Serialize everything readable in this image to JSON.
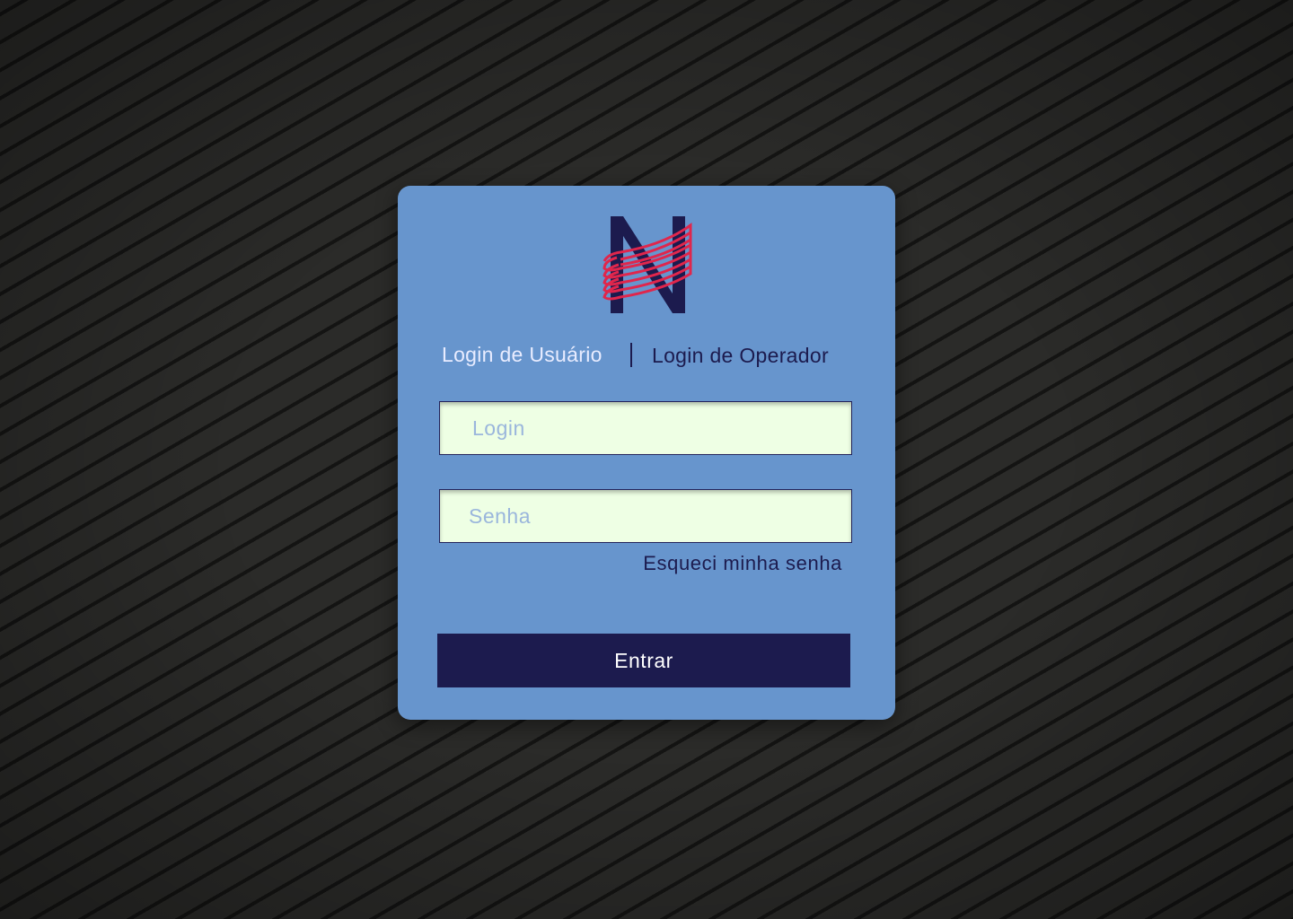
{
  "tabs": {
    "user_label": "Login de Usuário",
    "operator_label": "Login de Operador"
  },
  "form": {
    "login_placeholder": "Login",
    "login_value": "",
    "password_placeholder": "Senha",
    "password_value": "",
    "forgot_label": "Esqueci minha senha",
    "submit_label": "Entrar"
  },
  "colors": {
    "card": "#6795cd",
    "primary": "#1c1b4e",
    "logo_accent": "#e0264c",
    "field_bg": "#eeffe4",
    "active_tab": "#e8ecff"
  },
  "logo": {
    "icon": "n-logo-icon"
  }
}
